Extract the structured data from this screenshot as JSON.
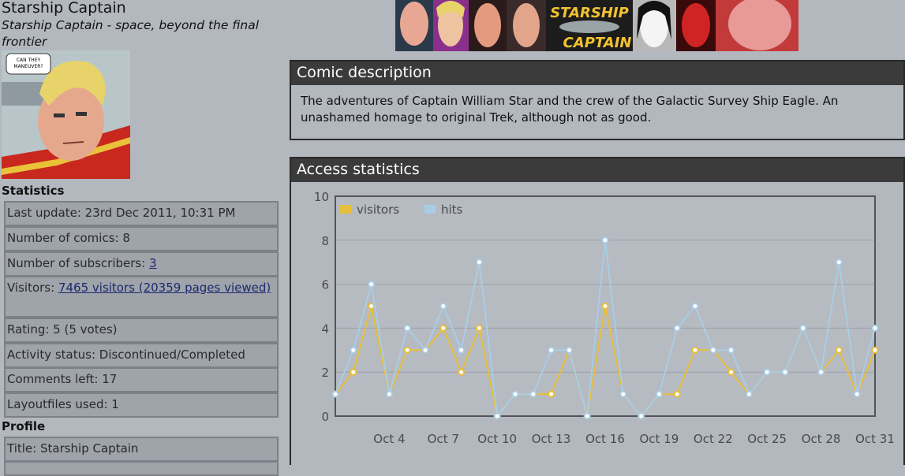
{
  "sidebar": {
    "title": "Starship Captain",
    "subtitle": "Starship Captain - space, beyond the final frontier",
    "thumb_bubble": "CAN THEY MANEUVER?",
    "statistics_heading": "Statistics",
    "stats": [
      {
        "label": "Last update: 23rd Dec 2011, 10:31 PM"
      },
      {
        "label": "Number of comics: 8"
      },
      {
        "label": "Number of subscribers: ",
        "link": "3"
      },
      {
        "label": "Visitors: ",
        "link": "7465 visitors (20359 pages viewed)"
      },
      {
        "label": "Rating: 5 (5 votes)"
      },
      {
        "label": "Activity status: Discontinued/Completed"
      },
      {
        "label": "Comments left: 17"
      },
      {
        "label": "Layoutfiles used: 1"
      }
    ],
    "profile_heading": "Profile",
    "profile": [
      {
        "label": "Title: Starship Captain"
      }
    ]
  },
  "banner": {
    "logo_line1": "STARSHIP",
    "logo_line2": "CAPTAIN"
  },
  "description": {
    "heading": "Comic description",
    "text": "The adventures of Captain William Star and the crew of the Galactic Survey Ship Eagle. An unashamed homage to original Trek, although not as good."
  },
  "statistics_panel": {
    "heading": "Access statistics"
  },
  "colors": {
    "visitors": "#e8bf3a",
    "hits": "#a9cde6",
    "panel_header": "#3b3b3b",
    "background": "#b3b7be"
  },
  "chart_data": {
    "type": "line",
    "x": [
      "Oct 1",
      "Oct 2",
      "Oct 3",
      "Oct 4",
      "Oct 5",
      "Oct 6",
      "Oct 7",
      "Oct 8",
      "Oct 9",
      "Oct 10",
      "Oct 11",
      "Oct 12",
      "Oct 13",
      "Oct 14",
      "Oct 15",
      "Oct 16",
      "Oct 17",
      "Oct 18",
      "Oct 19",
      "Oct 20",
      "Oct 21",
      "Oct 22",
      "Oct 23",
      "Oct 24",
      "Oct 25",
      "Oct 26",
      "Oct 27",
      "Oct 28",
      "Oct 29",
      "Oct 30",
      "Oct 31"
    ],
    "tick_labels": [
      "Oct 4",
      "Oct 7",
      "Oct 10",
      "Oct 13",
      "Oct 16",
      "Oct 19",
      "Oct 22",
      "Oct 25",
      "Oct 28",
      "Oct 31"
    ],
    "series": [
      {
        "name": "visitors",
        "values": [
          1,
          2,
          5,
          1,
          3,
          3,
          4,
          2,
          4,
          0,
          1,
          1,
          1,
          3,
          0,
          5,
          1,
          0,
          1,
          1,
          3,
          3,
          2,
          1,
          2,
          2,
          4,
          2,
          3,
          1,
          3
        ]
      },
      {
        "name": "hits",
        "values": [
          1,
          3,
          6,
          1,
          4,
          3,
          5,
          3,
          7,
          0,
          1,
          1,
          3,
          3,
          0,
          8,
          1,
          0,
          1,
          4,
          5,
          3,
          3,
          1,
          2,
          2,
          4,
          2,
          7,
          1,
          4
        ]
      }
    ],
    "ylim": [
      0,
      10
    ],
    "yticks": [
      0,
      2,
      4,
      6,
      8,
      10
    ],
    "grid": true,
    "legend": "top-left"
  }
}
